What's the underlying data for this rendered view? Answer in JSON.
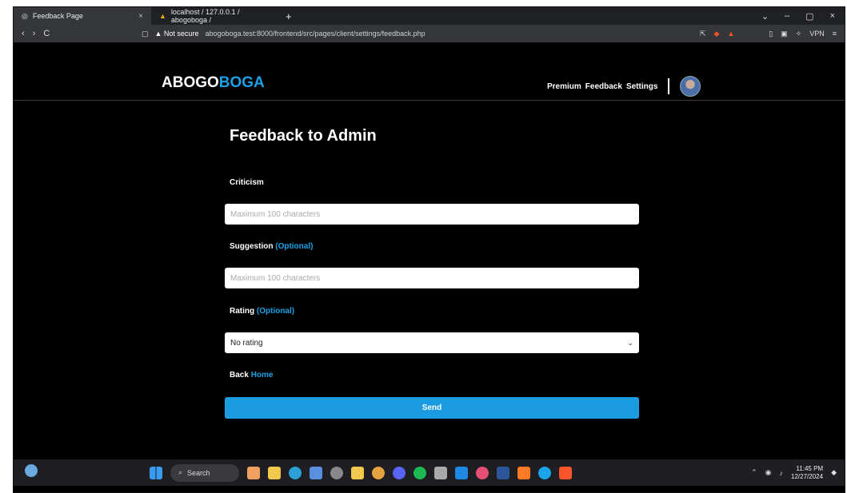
{
  "browser": {
    "tabs": [
      {
        "title": "Feedback Page",
        "close": "×"
      },
      {
        "title": "localhost / 127.0.0.1 / abogoboga /"
      }
    ],
    "new_tab": "+",
    "window_controls": [
      "⌄",
      "–",
      "▢",
      "×"
    ],
    "nav": [
      "‹",
      "›",
      "C"
    ],
    "security": "▲ Not secure",
    "url": "abogoboga.test:8000/frontend/src/pages/client/settings/feedback.php",
    "vpn": "VPN"
  },
  "header": {
    "brand_part1": "ABOGO",
    "brand_part2": "BOGA",
    "nav": {
      "premium": "Premium",
      "feedback": "Feedback",
      "settings": "Settings"
    }
  },
  "form": {
    "title": "Feedback to Admin",
    "criticism_label": "Criticism",
    "criticism_placeholder": "Maximum 100 characters",
    "suggestion_label": "Suggestion",
    "suggestion_opt": "(Optional)",
    "suggestion_placeholder": "Maximum 100 characters",
    "rating_label": "Rating",
    "rating_opt": "(Optional)",
    "rating_selected": "No rating",
    "back_label": "Back",
    "home_label": "Home",
    "send_label": "Send"
  },
  "taskbar": {
    "search_label": "Search",
    "time": "11:45 PM",
    "date": "12/27/2024"
  },
  "colors": {
    "accent": "#1da1e6",
    "send": "#1b9be0",
    "bg": "#000000"
  }
}
